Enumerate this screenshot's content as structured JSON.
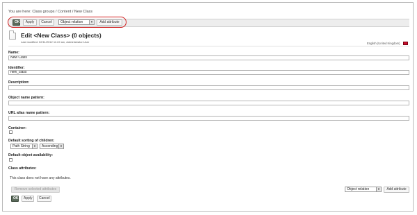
{
  "breadcrumb": "You are here: Class groups / Content / New Class",
  "toolbar": {
    "ok_label": "OK",
    "apply_label": "Apply",
    "cancel_label": "Cancel",
    "attribute_type": "Object relation",
    "add_attribute_label": "Add attribute"
  },
  "header": {
    "title": "Edit <New Class> (0 objects)",
    "last_modified": "Last modified: 02/11/2012 11:22 am, Administrator User",
    "language": "English (United Kingdom)"
  },
  "fields": {
    "name_label": "Name:",
    "name_value": "New Class",
    "identifier_label": "Identifier:",
    "identifier_value": "new_class",
    "description_label": "Description:",
    "description_value": "",
    "object_name_pattern_label": "Object name pattern:",
    "object_name_pattern_value": "",
    "url_alias_label": "URL alias name pattern:",
    "url_alias_value": "",
    "container_label": "Container:",
    "sorting_label": "Default sorting of children:",
    "sort_field": "Path String",
    "sort_order": "Ascending",
    "availability_label": "Default object availability:"
  },
  "class_attributes": {
    "heading": "Class attributes:",
    "empty_message": "This class does not have any attributes.",
    "remove_label": "Remove selected attributes",
    "attribute_type": "Object relation",
    "add_attribute_label": "Add attribute"
  },
  "bottom_toolbar": {
    "ok_label": "OK",
    "apply_label": "Apply",
    "cancel_label": "Cancel"
  },
  "colors": {
    "highlight": "#d11a1a",
    "ok_button": "#5a6a5a"
  }
}
